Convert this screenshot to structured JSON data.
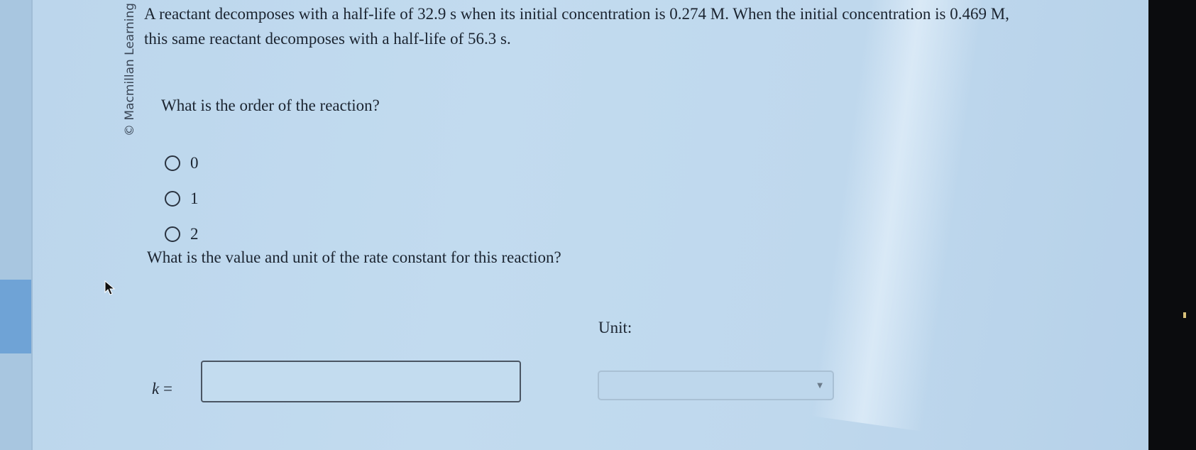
{
  "watermark": "© Macmillan Learning",
  "problem": {
    "statement": "A reactant decomposes with a half-life of 32.9 s when its initial concentration is 0.274 M. When the initial concentration is 0.469 M, this same reactant decomposes with a half-life of 56.3 s.",
    "order_question": "What is the order of the reaction?",
    "order_options": [
      {
        "label": "0"
      },
      {
        "label": "1"
      },
      {
        "label": "2"
      }
    ],
    "k_question": "What is the value and unit of the rate constant for this reaction?",
    "k_symbol": "k",
    "k_equals": " =",
    "k_value": "",
    "unit_label": "Unit:",
    "unit_selected": ""
  },
  "icons": {
    "radio": "radio-circle-icon",
    "caret": "chevron-down-icon",
    "cursor": "mouse-pointer-icon"
  },
  "colors": {
    "panel_bg": "#bfd8ed",
    "accent": "#6fa3d6",
    "bezel": "#0b0c0e"
  }
}
